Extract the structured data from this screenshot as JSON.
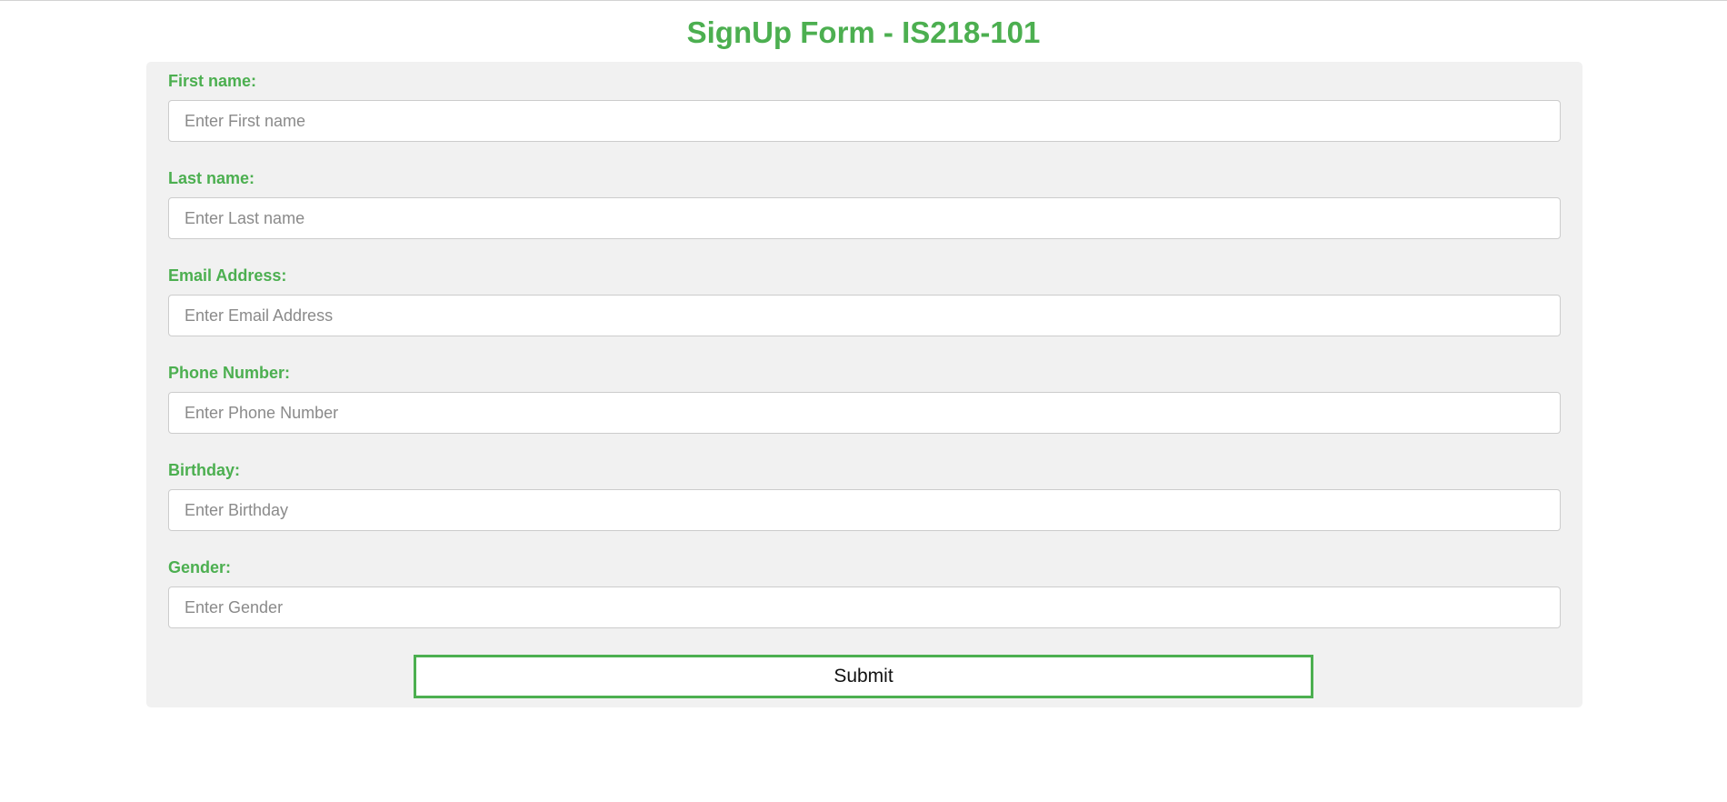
{
  "page": {
    "title": "SignUp Form - IS218-101"
  },
  "form": {
    "fields": [
      {
        "label": "First name:",
        "placeholder": "Enter First name",
        "value": ""
      },
      {
        "label": "Last name:",
        "placeholder": "Enter Last name",
        "value": ""
      },
      {
        "label": "Email Address:",
        "placeholder": "Enter Email Address",
        "value": ""
      },
      {
        "label": "Phone Number:",
        "placeholder": "Enter Phone Number",
        "value": ""
      },
      {
        "label": "Birthday:",
        "placeholder": "Enter Birthday",
        "value": ""
      },
      {
        "label": "Gender:",
        "placeholder": "Enter Gender",
        "value": ""
      }
    ],
    "submit_label": "Submit"
  },
  "colors": {
    "accent": "#4caf50",
    "panel_background": "#f1f1f1",
    "input_border": "#cccccc"
  }
}
